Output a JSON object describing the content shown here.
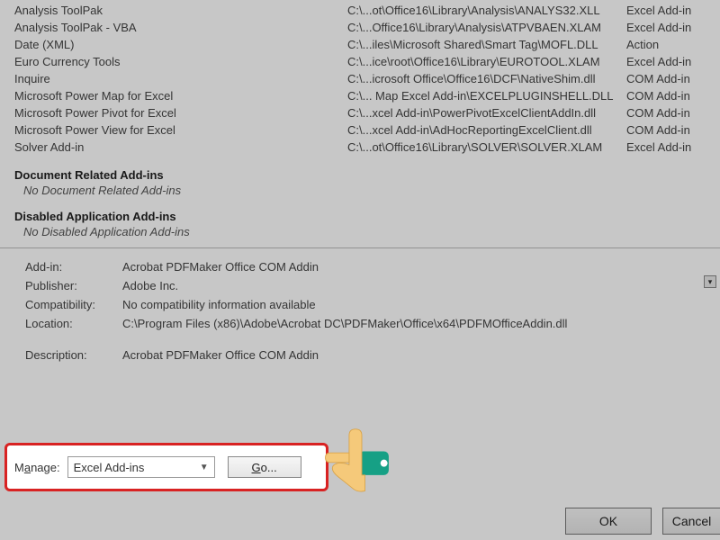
{
  "addins": {
    "rows": [
      {
        "name": "Analysis ToolPak",
        "path": "C:\\...ot\\Office16\\Library\\Analysis\\ANALYS32.XLL",
        "type": "Excel Add-in"
      },
      {
        "name": "Analysis ToolPak - VBA",
        "path": "C:\\...Office16\\Library\\Analysis\\ATPVBAEN.XLAM",
        "type": "Excel Add-in"
      },
      {
        "name": "Date (XML)",
        "path": "C:\\...iles\\Microsoft Shared\\Smart Tag\\MOFL.DLL",
        "type": "Action"
      },
      {
        "name": "Euro Currency Tools",
        "path": "C:\\...ice\\root\\Office16\\Library\\EUROTOOL.XLAM",
        "type": "Excel Add-in"
      },
      {
        "name": "Inquire",
        "path": "C:\\...icrosoft Office\\Office16\\DCF\\NativeShim.dll",
        "type": "COM Add-in"
      },
      {
        "name": "Microsoft Power Map for Excel",
        "path": "C:\\... Map Excel Add-in\\EXCELPLUGINSHELL.DLL",
        "type": "COM Add-in"
      },
      {
        "name": "Microsoft Power Pivot for Excel",
        "path": "C:\\...xcel Add-in\\PowerPivotExcelClientAddIn.dll",
        "type": "COM Add-in"
      },
      {
        "name": "Microsoft Power View for Excel",
        "path": "C:\\...xcel Add-in\\AdHocReportingExcelClient.dll",
        "type": "COM Add-in"
      },
      {
        "name": "Solver Add-in",
        "path": "C:\\...ot\\Office16\\Library\\SOLVER\\SOLVER.XLAM",
        "type": "Excel Add-in"
      }
    ],
    "section_doc": "Document Related Add-ins",
    "no_doc": "No Document Related Add-ins",
    "section_disabled": "Disabled Application Add-ins",
    "no_disabled": "No Disabled Application Add-ins"
  },
  "details": {
    "addin_label": "Add-in:",
    "addin_val": "Acrobat PDFMaker Office COM Addin",
    "publisher_label": "Publisher:",
    "publisher_val": "Adobe Inc.",
    "compat_label": "Compatibility:",
    "compat_val": "No compatibility information available",
    "location_label": "Location:",
    "location_val": "C:\\Program Files (x86)\\Adobe\\Acrobat DC\\PDFMaker\\Office\\x64\\PDFMOfficeAddin.dll",
    "desc_label": "Description:",
    "desc_val": "Acrobat PDFMaker Office COM Addin"
  },
  "manage": {
    "label_prefix": "M",
    "label_underline": "a",
    "label_suffix": "nage:",
    "selected": "Excel Add-ins",
    "go_underline": "G",
    "go_suffix": "o..."
  },
  "buttons": {
    "ok": "OK",
    "cancel": "Cancel"
  }
}
